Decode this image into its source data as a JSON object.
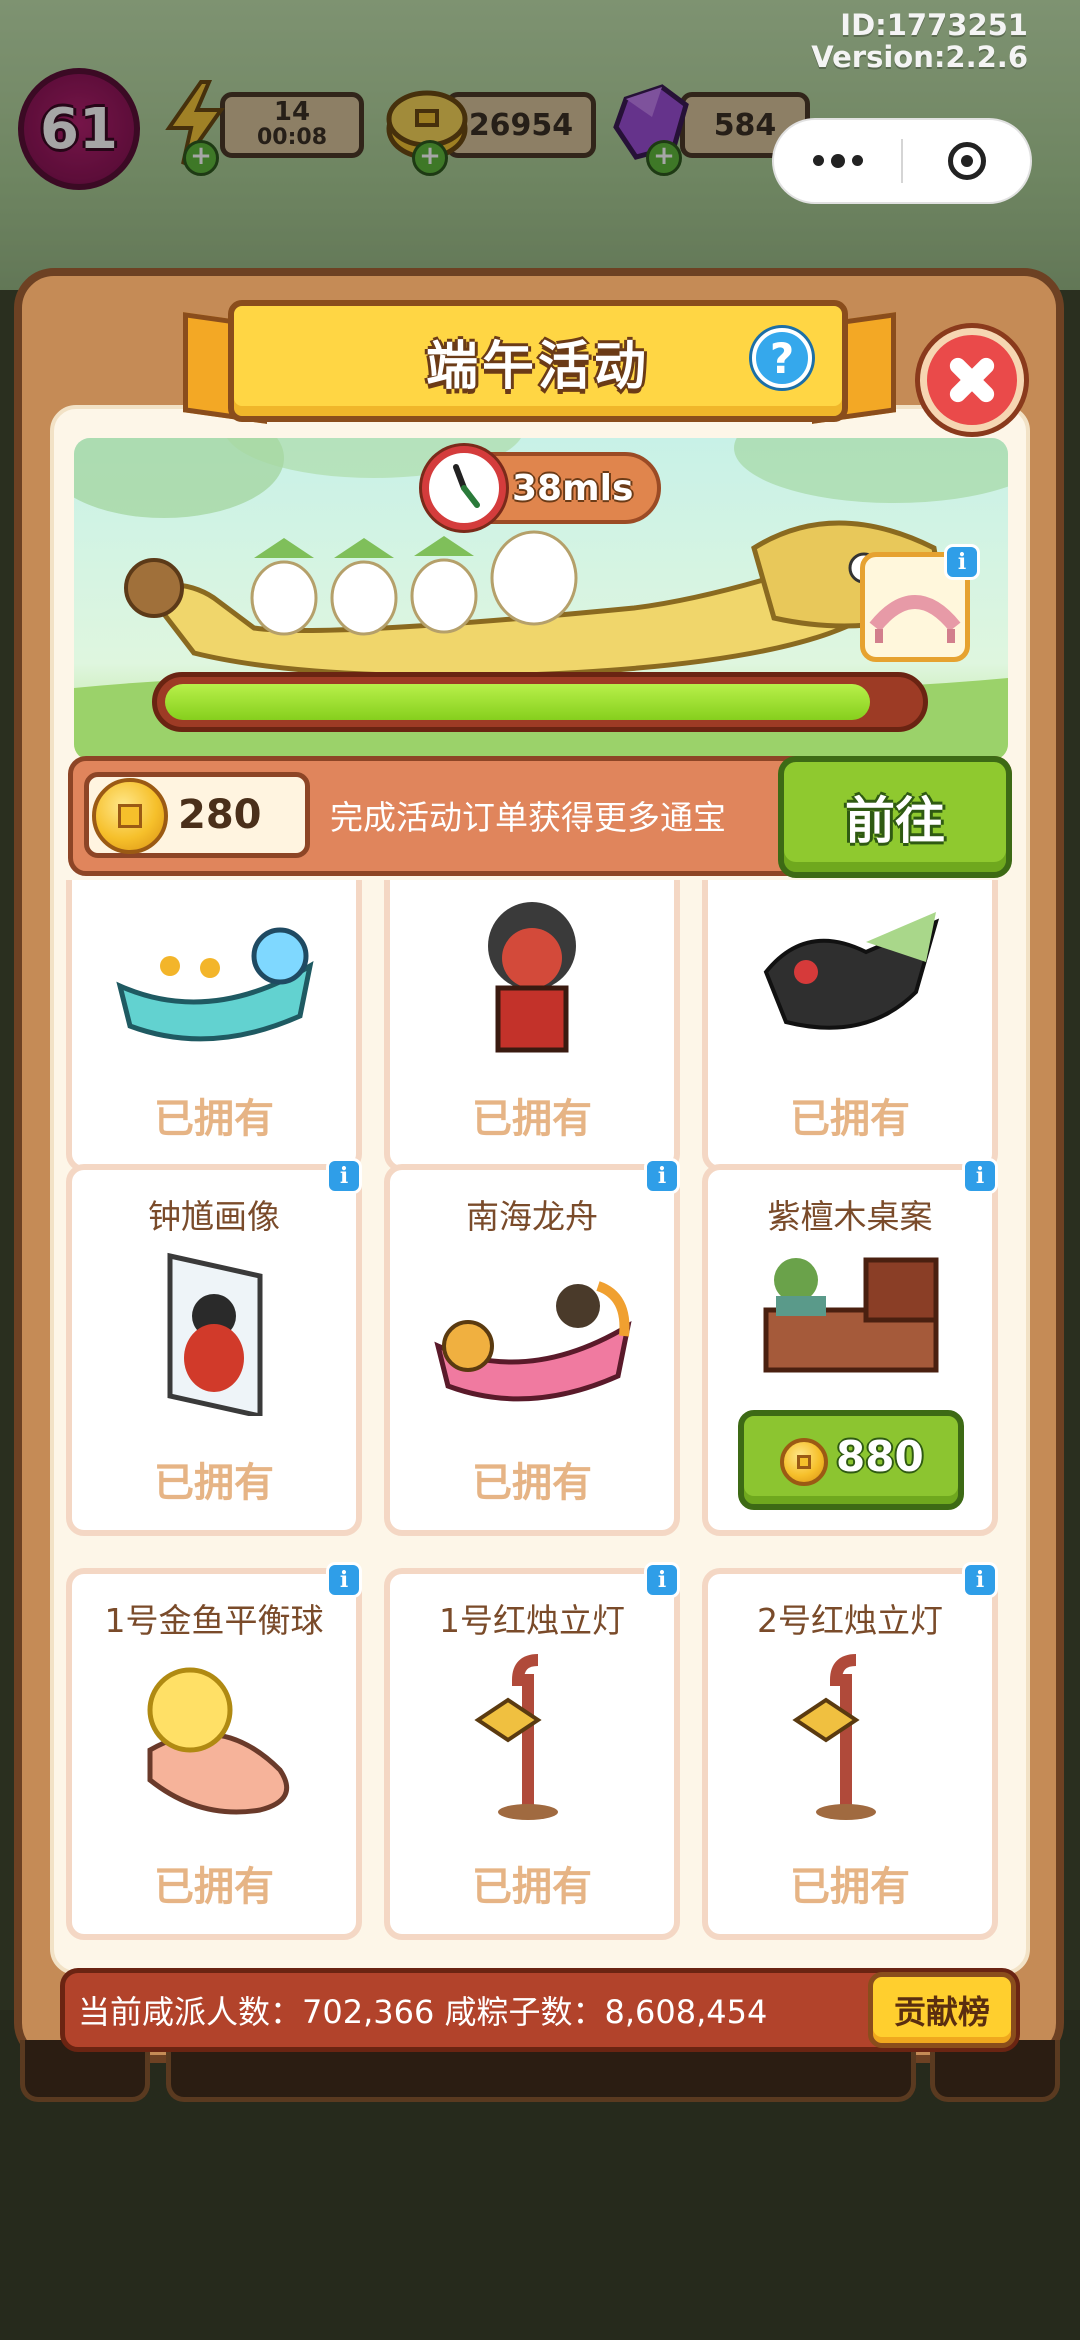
{
  "meta": {
    "id_text": "ID:1773251",
    "version_text": "Version:2.2.6"
  },
  "hud": {
    "level": "61",
    "energy": {
      "value": "14",
      "timer": "00:08"
    },
    "coins": "26954",
    "gems": "584"
  },
  "panel": {
    "title": "端午活动",
    "help_symbol": "?",
    "timer": "38mls",
    "progress_fraction": 0.94,
    "info_badge": "i",
    "bar": {
      "currency_amount": "280",
      "message": "完成活动订单获得更多通宝",
      "goto_label": "前往"
    }
  },
  "items": [
    {
      "name": "",
      "status": "已拥有",
      "art": "dragon-boat-teal"
    },
    {
      "name": "",
      "status": "已拥有",
      "art": "warrior-figure"
    },
    {
      "name": "",
      "status": "已拥有",
      "art": "dragon-head-black"
    },
    {
      "name": "钟馗画像",
      "status": "已拥有",
      "art": "zhongkui-portrait"
    },
    {
      "name": "南海龙舟",
      "status": "已拥有",
      "art": "dragon-boat-pink"
    },
    {
      "name": "紫檀木桌案",
      "status": "",
      "price": "880",
      "art": "rosewood-desk"
    },
    {
      "name": "1号金鱼平衡球",
      "status": "已拥有",
      "art": "goldfish-ball"
    },
    {
      "name": "1号红烛立灯",
      "status": "已拥有",
      "art": "candle-lamp"
    },
    {
      "name": "2号红烛立灯",
      "status": "已拥有",
      "art": "candle-lamp"
    }
  ],
  "footer": {
    "stats_text": "当前咸派人数：702,366  咸粽子数：8,608,454",
    "rank_label": "贡献榜"
  },
  "colors": {
    "accent_green": "#8fc92f",
    "title_yellow": "#ffd644",
    "close_red": "#ea4a4a",
    "owned_text": "#e6b485"
  }
}
